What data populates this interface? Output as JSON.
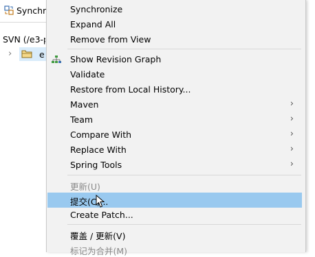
{
  "view": {
    "tab_label": "Synchronize",
    "svn_label": "SVN (/e3-p",
    "tree_item": "e"
  },
  "menu": {
    "items": [
      {
        "label": "Synchronize",
        "arrow": ""
      },
      {
        "label": "Expand All",
        "arrow": ""
      },
      {
        "label": "Remove from View",
        "arrow": ""
      },
      {
        "label": "Show Revision Graph",
        "arrow": ""
      },
      {
        "label": "Validate",
        "arrow": ""
      },
      {
        "label": "Restore from Local History...",
        "arrow": ""
      },
      {
        "label": "Maven",
        "arrow": "›"
      },
      {
        "label": "Team",
        "arrow": "›"
      },
      {
        "label": "Compare With",
        "arrow": "›"
      },
      {
        "label": "Replace With",
        "arrow": "›"
      },
      {
        "label": "Spring Tools",
        "arrow": "›"
      },
      {
        "label": "更新(U)",
        "arrow": ""
      },
      {
        "label": "提交(C)...",
        "arrow": ""
      },
      {
        "label": "Create Patch...",
        "arrow": ""
      },
      {
        "label": "覆盖 / 更新(V)",
        "arrow": ""
      },
      {
        "label": "标记为合并(M)",
        "arrow": ""
      }
    ]
  },
  "colors": {
    "menu_bg": "#f2f2f2",
    "highlight": "#99c9ef",
    "selection": "#d9ecfb",
    "disabled_text": "#8a8a8a"
  }
}
